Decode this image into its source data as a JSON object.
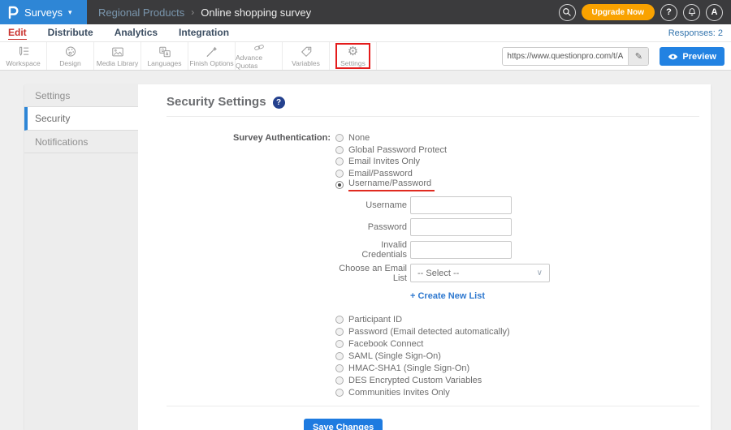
{
  "topbar": {
    "logo": "P",
    "app_menu": "Surveys",
    "breadcrumb": [
      "Regional Products",
      "Online shopping survey"
    ],
    "upgrade_label": "Upgrade Now",
    "help_label": "?",
    "avatar_label": "A"
  },
  "tabs": {
    "items": [
      "Edit",
      "Distribute",
      "Analytics",
      "Integration"
    ],
    "active_tab": "Edit",
    "responses_label": "Responses: 2"
  },
  "toolbar": {
    "items": [
      "Workspace",
      "Design",
      "Media Library",
      "Languages",
      "Finish Options",
      "Advance Quotas",
      "Variables",
      "Settings"
    ],
    "active_item": "Settings",
    "survey_url": "https://www.questionpro.com/t/APNrfZ",
    "preview_label": "Preview"
  },
  "sidebar": {
    "items": [
      {
        "label": "Settings",
        "active": false
      },
      {
        "label": "Security",
        "active": true
      },
      {
        "label": "Notifications",
        "active": false
      }
    ]
  },
  "main": {
    "title": "Security Settings",
    "auth_label": "Survey Authentication:",
    "auth_options_top": [
      "None",
      "Global Password Protect",
      "Email Invites Only",
      "Email/Password",
      "Username/Password"
    ],
    "auth_selected": "Username/Password",
    "fields": [
      {
        "label": "Username",
        "value": ""
      },
      {
        "label": "Password",
        "value": ""
      },
      {
        "label": "Invalid Credentials",
        "value": ""
      }
    ],
    "email_list": {
      "label": "Choose an Email List",
      "value": "-- Select --",
      "create_link": "+ Create New List"
    },
    "auth_options_bottom": [
      "Participant ID",
      "Password (Email detected automatically)",
      "Facebook Connect",
      "SAML (Single Sign-On)",
      "HMAC-SHA1 (Single Sign-On)",
      "DES Encrypted Custom Variables",
      "Communities Invites Only"
    ],
    "save_label": "Save Changes"
  },
  "glyphs": {
    "caret_down": "▾",
    "crumb_sep": "›",
    "edit_pencil": "✎",
    "select_chevron": "∨",
    "gear": "⚙"
  },
  "colors": {
    "topbar_bg": "#3b3b3d",
    "brand_blue": "#2e86d6",
    "upgrade_orange": "#f9a200",
    "active_tab_red": "#c9302c",
    "annotation_red": "#e41b1b",
    "link_blue": "#2e78cf",
    "preview_blue": "#2282e2",
    "help_navy": "#24418e",
    "save_blue": "#1e7be0"
  }
}
